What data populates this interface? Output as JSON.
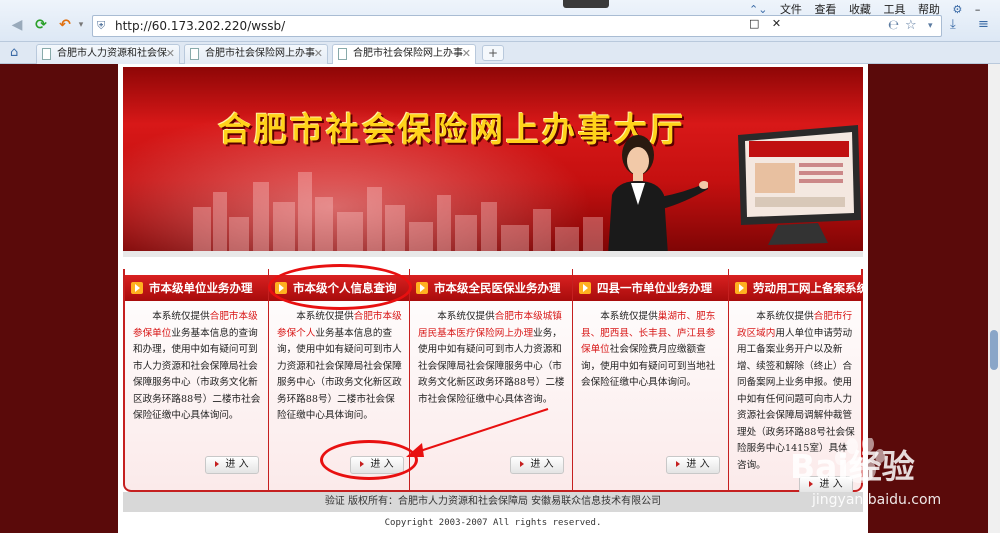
{
  "browser": {
    "url": "http://60.173.202.220/wssb/",
    "menu": [
      "文件",
      "查看",
      "收藏",
      "工具",
      "帮助"
    ],
    "tabs": [
      {
        "label": "合肥市人力资源和社会保"
      },
      {
        "label": "合肥市社会保险网上办事"
      },
      {
        "label": "合肥市社会保险网上办事"
      }
    ]
  },
  "banner": {
    "title": "合肥市社会保险网上办事大厅"
  },
  "panels": [
    {
      "header": "市本级单位业务办理",
      "body_pre": "本系统仅提供",
      "body_hl": "合肥市本级参保单位",
      "body_post": "业务基本信息的查询和办理，使用中如有疑问可到市人力资源和社会保障局社会保障服务中心（市政务文化新区政务环路88号）二楼市社会保险征缴中心具体询问。",
      "button": "进 入"
    },
    {
      "header": "市本级个人信息查询",
      "body_pre": "本系统仅提供",
      "body_hl": "合肥市本级参保个人",
      "body_post": "业务基本信息的查询，使用中如有疑问可到市人力资源和社会保障局社会保障服务中心（市政务文化新区政务环路88号）二楼市社会保险征缴中心具体询问。",
      "button": "进 入"
    },
    {
      "header": "市本级全民医保业务办理",
      "body_pre": "本系统仅提供",
      "body_hl": "合肥市本级城镇居民基本医疗保险网上办理",
      "body_post": "业务，使用中如有疑问可到市人力资源和社会保障局社会保障服务中心（市政务文化新区政务环路88号）二楼市社会保险征缴中心具体咨询。",
      "button": "进 入"
    },
    {
      "header": "四县一市单位业务办理",
      "body_pre": "本系统仅提供",
      "body_hl": "巢湖市、肥东县、肥西县、长丰县、庐江县参保单位",
      "body_post": "社会保险费月应缴额查询，使用中如有疑问可到当地社会保险征缴中心具体询问。",
      "button": "进 入"
    },
    {
      "header": "劳动用工网上备案系统",
      "body_pre": "本系统仅提供",
      "body_hl": "合肥市行政区域内",
      "body_post": "用人单位申请劳动用工备案业务开户以及新增、续签和解除（终止）合同备案网上业务申报。使用中如有任何问题可向市人力资源社会保障局调解仲裁管理处（政务环路88号社会保险服务中心1415室）具体咨询。",
      "button": "进 入"
    }
  ],
  "footer": {
    "line1": "验证 版权所有：合肥市人力资源和社会保障局    安徽易联众信息技术有限公司",
    "line2": "Copyright 2003-2007 All rights reserved."
  },
  "watermark": {
    "brand": "Bai经验",
    "url": "jingyan.baidu.com"
  }
}
